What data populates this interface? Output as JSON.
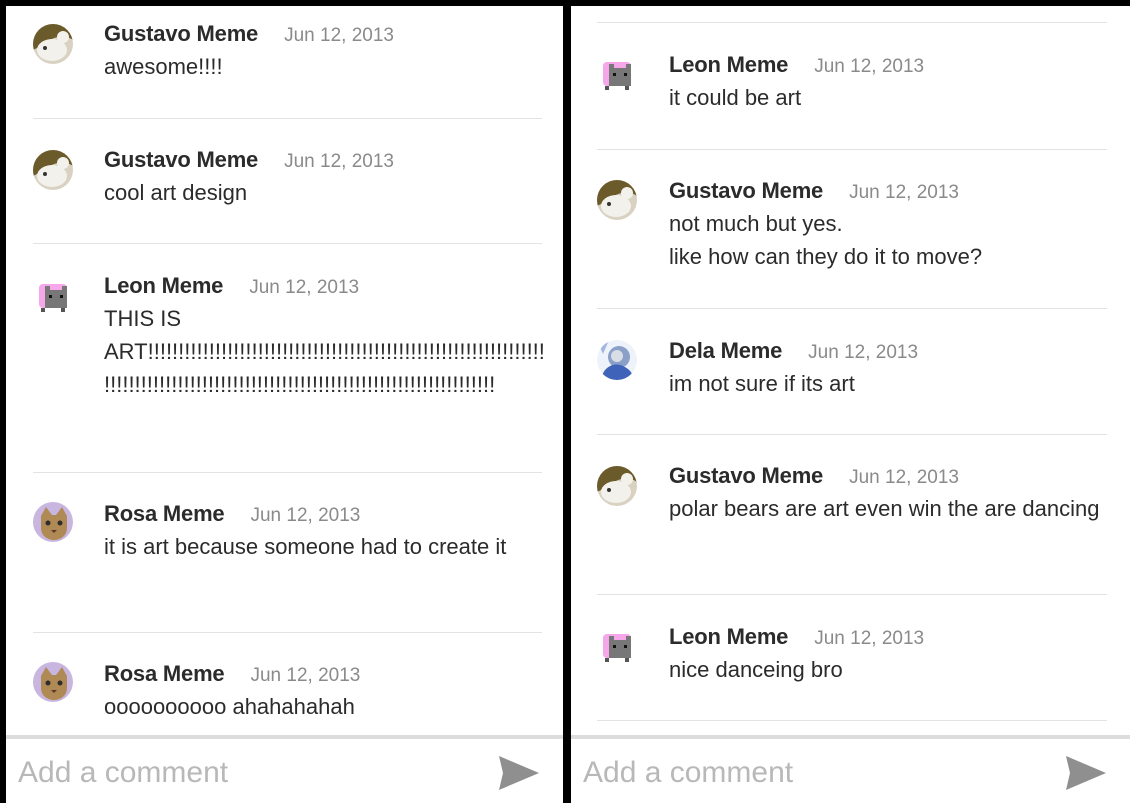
{
  "left_panel": {
    "comments": [
      {
        "author": "Gustavo Meme",
        "date": "Jun 12, 2013",
        "text": "awesome!!!!",
        "avatar": "polar-bear-avatar"
      },
      {
        "author": "Gustavo Meme",
        "date": "Jun 12, 2013",
        "text": "cool art design",
        "avatar": "polar-bear-avatar"
      },
      {
        "author": "Leon Meme",
        "date": "Jun 12, 2013",
        "text": "THIS IS ART!!!!!!!!!!!!!!!!!!!!!!!!!!!!!!!!!!!!!!!!!!!!!!!!!!!!!!!!!!!!!!!!!!!!!!!!!!!!!!!!!!!!!!!!!!!!!!!!!!!!!!!!!!!!!!!!!!!!!!!!!!!!!!!!!",
        "avatar": "nyan-cat-avatar"
      },
      {
        "author": "Rosa Meme",
        "date": "Jun 12, 2013",
        "text": "it is art because someone had to create it",
        "avatar": "cat-avatar"
      },
      {
        "author": "Rosa Meme",
        "date": "Jun 12, 2013",
        "text": "oooooooooo ahahahahah",
        "avatar": "cat-avatar"
      }
    ],
    "composer": {
      "placeholder": "Add a comment"
    }
  },
  "right_panel": {
    "comments": [
      {
        "author": "Leon Meme",
        "date": "Jun 12, 2013",
        "text": "it could be art",
        "avatar": "nyan-cat-avatar"
      },
      {
        "author": "Gustavo Meme",
        "date": "Jun 12, 2013",
        "text": "not much but yes.\nlike how can they do it to move?",
        "avatar": "polar-bear-avatar"
      },
      {
        "author": "Dela Meme",
        "date": "Jun 12, 2013",
        "text": "im not sure if its art",
        "avatar": "blue-portrait-avatar"
      },
      {
        "author": "Gustavo Meme",
        "date": "Jun 12, 2013",
        "text": "polar bears are art even win the are dancing",
        "avatar": "polar-bear-avatar"
      },
      {
        "author": "Leon Meme",
        "date": "Jun 12, 2013",
        "text": "nice danceing bro",
        "avatar": "nyan-cat-avatar"
      }
    ],
    "composer": {
      "placeholder": "Add a comment"
    }
  },
  "icons": {
    "send": "send-icon"
  },
  "colors": {
    "divider": "#e3e3e3",
    "author": "#2b2b2b",
    "date": "#8a8a8a",
    "placeholder": "#b8b8b8",
    "send_icon": "#8f8f8f",
    "frame": "#000000"
  }
}
